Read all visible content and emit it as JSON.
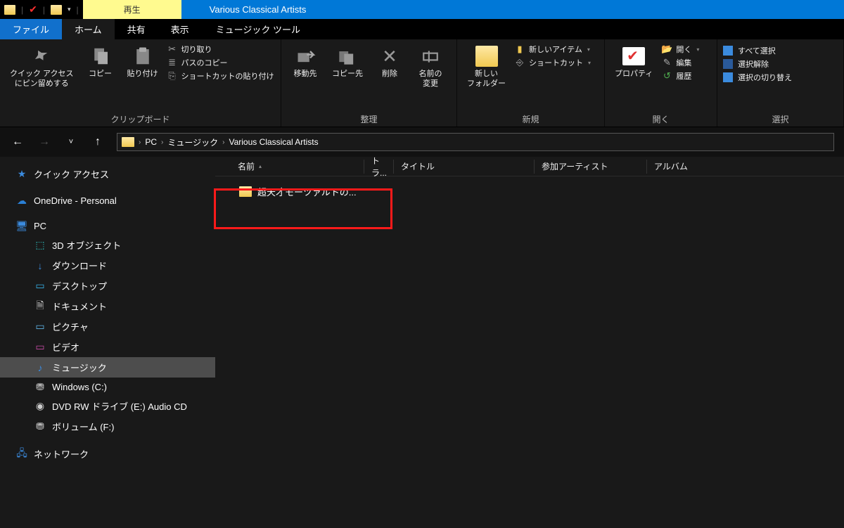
{
  "titlebar": {
    "context_tab": "再生",
    "window_title": "Various Classical Artists"
  },
  "tabs": {
    "file": "ファイル",
    "home": "ホーム",
    "share": "共有",
    "view": "表示",
    "music_tools": "ミュージック ツール"
  },
  "ribbon": {
    "clipboard": {
      "pin": "クイック アクセス\nにピン留めする",
      "copy": "コピー",
      "paste": "貼り付け",
      "cut": "切り取り",
      "copy_path": "パスのコピー",
      "paste_shortcut": "ショートカットの貼り付け",
      "label": "クリップボード"
    },
    "organize": {
      "move_to": "移動先",
      "copy_to": "コピー先",
      "delete": "削除",
      "rename": "名前の\n変更",
      "label": "整理"
    },
    "new": {
      "new_folder": "新しい\nフォルダー",
      "new_item": "新しいアイテム",
      "shortcut": "ショートカット",
      "label": "新規"
    },
    "open": {
      "properties": "プロパティ",
      "open": "開く",
      "edit": "編集",
      "history": "履歴",
      "label": "開く"
    },
    "select": {
      "select_all": "すべて選択",
      "select_none": "選択解除",
      "invert": "選択の切り替え",
      "label": "選択"
    }
  },
  "breadcrumb": {
    "pc": "PC",
    "music": "ミュージック",
    "folder": "Various Classical Artists"
  },
  "nav": {
    "quick_access": "クイック アクセス",
    "onedrive": "OneDrive - Personal",
    "pc": "PC",
    "objects3d": "3D オブジェクト",
    "downloads": "ダウンロード",
    "desktop": "デスクトップ",
    "documents": "ドキュメント",
    "pictures": "ピクチャ",
    "videos": "ビデオ",
    "music": "ミュージック",
    "drive_c": "Windows (C:)",
    "drive_e": "DVD RW ドライブ (E:) Audio CD",
    "drive_f": "ボリューム (F:)",
    "network": "ネットワーク"
  },
  "columns": {
    "name": "名前",
    "track": "トラ...",
    "title": "タイトル",
    "artist": "参加アーティスト",
    "album": "アルバム"
  },
  "file": {
    "name": "超天才モーツァルトの..."
  }
}
